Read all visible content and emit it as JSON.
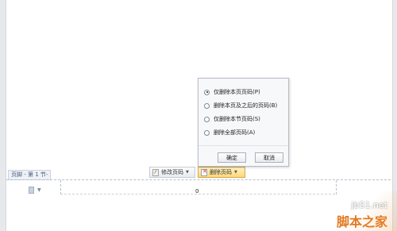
{
  "footer": {
    "tag_label": "页脚 - 第 1 节-",
    "page_number": "0",
    "doc_menu_arrow": "▼"
  },
  "toolbar": {
    "modify_label": "修改页码",
    "delete_label": "删除页码"
  },
  "dropdown": {
    "options": [
      {
        "label": "仅删除本页页码(P)",
        "selected": true
      },
      {
        "label": "删除本页及之后的页码(B)",
        "selected": false
      },
      {
        "label": "仅删除本节页码(S)",
        "selected": false
      },
      {
        "label": "删除全部页码(A)",
        "selected": false
      }
    ],
    "ok_label": "确定",
    "cancel_label": "取消"
  },
  "watermark": {
    "site": "jb51.net",
    "brand": "脚本之家"
  }
}
